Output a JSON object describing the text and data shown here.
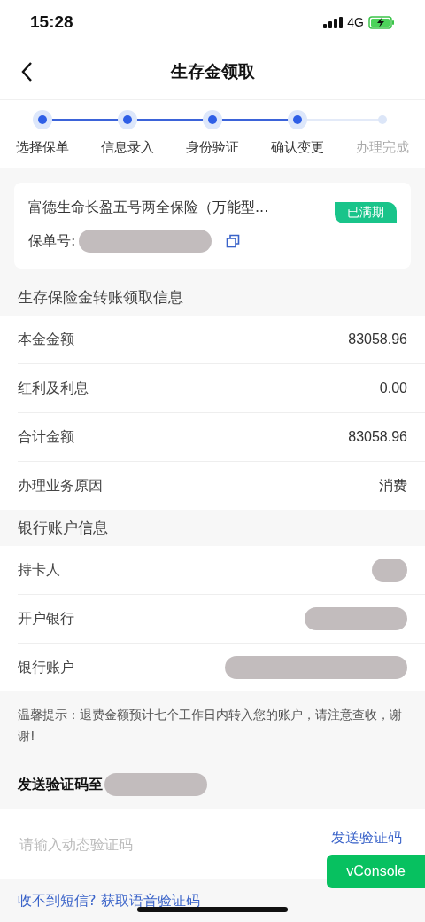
{
  "status_bar": {
    "time": "15:28",
    "network": "4G"
  },
  "nav": {
    "title": "生存金领取"
  },
  "steps": [
    {
      "label": "选择保单",
      "completed": true
    },
    {
      "label": "信息录入",
      "completed": true
    },
    {
      "label": "身份验证",
      "completed": true
    },
    {
      "label": "确认变更",
      "completed": true
    },
    {
      "label": "办理完成",
      "completed": false
    }
  ],
  "policy": {
    "name": "富德生命长盈五号两全保险（万能型...",
    "badge": "已满期",
    "number_label": "保单号:"
  },
  "transfer_section": {
    "title": "生存保险金转账领取信息",
    "rows": [
      {
        "label": "本金金额",
        "value": "83058.96"
      },
      {
        "label": "红利及利息",
        "value": "0.00"
      },
      {
        "label": "合计金额",
        "value": "83058.96"
      },
      {
        "label": "办理业务原因",
        "value": "消费"
      }
    ]
  },
  "bank_section": {
    "title": "银行账户信息",
    "rows": [
      {
        "label": "持卡人"
      },
      {
        "label": "开户银行"
      },
      {
        "label": "银行账户"
      }
    ]
  },
  "tip": "温馨提示：退费金额预计七个工作日内转入您的账户，请注意查收，谢谢!",
  "verify": {
    "send_to_label": "发送验证码至",
    "placeholder": "请输入动态验证码",
    "send_button": "发送验证码",
    "voice_link": "收不到短信? 获取语音验证码"
  },
  "vconsole": "vConsole"
}
